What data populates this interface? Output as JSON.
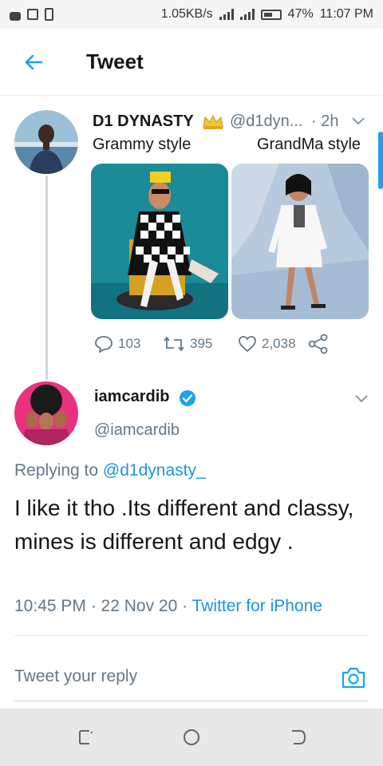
{
  "status_bar": {
    "speed": "1.05KB/s",
    "battery": "47%",
    "time": "11:07 PM"
  },
  "header": {
    "title": "Tweet",
    "back_icon": "arrow-left-icon"
  },
  "original_tweet": {
    "name": "D1 DYNASTY",
    "name_icon": "crown-emoji",
    "handle": "@d1dyn...",
    "time": "· 2h",
    "caption_left": "Grammy style",
    "caption_right": "GrandMa style",
    "replies": "103",
    "retweets": "395",
    "likes": "2,038"
  },
  "reply_tweet": {
    "name": "iamcardib",
    "handle": "@iamcardib",
    "replying_prefix": "Replying to ",
    "replying_to": "@d1dynasty_",
    "text": "I like it tho .Its different and classy, mines is different and edgy .",
    "timestamp": "10:45 PM · 22 Nov 20 · ",
    "source": "Twitter for iPhone"
  },
  "composer": {
    "placeholder": "Tweet your reply"
  },
  "colors": {
    "accent": "#1da1f2",
    "secondary_text": "#657786"
  }
}
